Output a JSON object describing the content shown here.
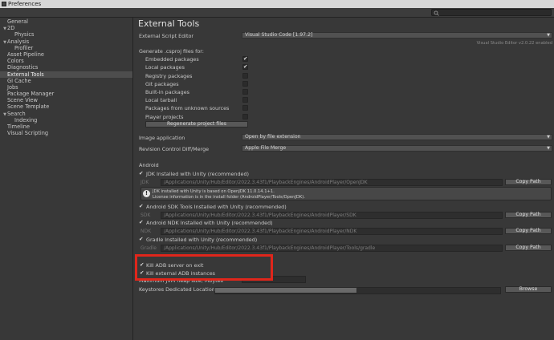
{
  "window": {
    "title": "Preferences"
  },
  "sidebar": {
    "items": [
      {
        "label": "General",
        "indent": 0,
        "arrow": ""
      },
      {
        "label": "2D",
        "indent": 0,
        "arrow": "▼"
      },
      {
        "label": "Physics",
        "indent": 1,
        "arrow": ""
      },
      {
        "label": "Analysis",
        "indent": 0,
        "arrow": "▼"
      },
      {
        "label": "Profiler",
        "indent": 1,
        "arrow": ""
      },
      {
        "label": "Asset Pipeline",
        "indent": 0,
        "arrow": ""
      },
      {
        "label": "Colors",
        "indent": 0,
        "arrow": ""
      },
      {
        "label": "Diagnostics",
        "indent": 0,
        "arrow": ""
      },
      {
        "label": "External Tools",
        "indent": 0,
        "arrow": "",
        "selected": true
      },
      {
        "label": "GI Cache",
        "indent": 0,
        "arrow": ""
      },
      {
        "label": "Jobs",
        "indent": 0,
        "arrow": ""
      },
      {
        "label": "Package Manager",
        "indent": 0,
        "arrow": ""
      },
      {
        "label": "Scene View",
        "indent": 0,
        "arrow": ""
      },
      {
        "label": "Scene Template",
        "indent": 0,
        "arrow": ""
      },
      {
        "label": "Search",
        "indent": 0,
        "arrow": "▼"
      },
      {
        "label": "Indexing",
        "indent": 1,
        "arrow": ""
      },
      {
        "label": "Timeline",
        "indent": 0,
        "arrow": ""
      },
      {
        "label": "Visual Scripting",
        "indent": 0,
        "arrow": ""
      }
    ]
  },
  "content": {
    "title": "External Tools",
    "script_editor": {
      "label": "External Script Editor",
      "value": "Visual Studio Code [1.97.2]",
      "note": "Visual Studio Editor v2.0.22 enabled"
    },
    "csproj": {
      "label": "Generate .csproj files for:",
      "items": [
        {
          "label": "Embedded packages",
          "checked": true
        },
        {
          "label": "Local packages",
          "checked": true
        },
        {
          "label": "Registry packages",
          "checked": false
        },
        {
          "label": "Git packages",
          "checked": false
        },
        {
          "label": "Built-in packages",
          "checked": false
        },
        {
          "label": "Local tarball",
          "checked": false
        },
        {
          "label": "Packages from unknown sources",
          "checked": false
        },
        {
          "label": "Player projects",
          "checked": false
        }
      ],
      "regenerate_label": "Regenerate project files"
    },
    "image_app": {
      "label": "Image application",
      "value": "Open by file extension"
    },
    "revision": {
      "label": "Revision Control Diff/Merge",
      "value": "Apple File Merge"
    },
    "android": {
      "header": "Android",
      "jdk_toggle": "JDK Installed with Unity (recommended)",
      "jdk_prefix": "JDK",
      "jdk_path": "/Applications/Unity/Hub/Editor/2022.3.43f1/PlaybackEngines/AndroidPlayer/OpenJDK",
      "info_line1": "JDK installed with Unity is based on OpenJDK 11.0.14.1+1.",
      "info_line2": "License information is in the install folder (AndroidPlayer/Tools/OpenJDK).",
      "sdk_toggle": "Android SDK Tools Installed with Unity (recommended)",
      "sdk_prefix": "SDK",
      "sdk_path": "/Applications/Unity/Hub/Editor/2022.3.43f1/PlaybackEngines/AndroidPlayer/SDK",
      "ndk_toggle": "Android NDK Installed with Unity (recommended)",
      "ndk_prefix": "NDK",
      "ndk_path": "/Applications/Unity/Hub/Editor/2022.3.43f1/PlaybackEngines/AndroidPlayer/NDK",
      "gradle_toggle": "Gradle Installed with Unity (recommended)",
      "gradle_prefix": "Gradle",
      "gradle_path": "/Applications/Unity/Hub/Editor/2022.3.43f1/PlaybackEngines/AndroidPlayer/Tools/gradle",
      "copy_path_label": "Copy Path",
      "kill_adb": "Kill ADB server on exit",
      "kill_external_adb": "Kill external ADB instances",
      "max_heap_label": "Maximum JVM heap size, Mbytes",
      "max_heap_value": "4096",
      "keystores_label": "Keystores Dedicated Location",
      "browse_label": "Browse"
    }
  },
  "colors": {
    "highlight": "#e0261b",
    "selected_row": "#4d4d4d"
  }
}
